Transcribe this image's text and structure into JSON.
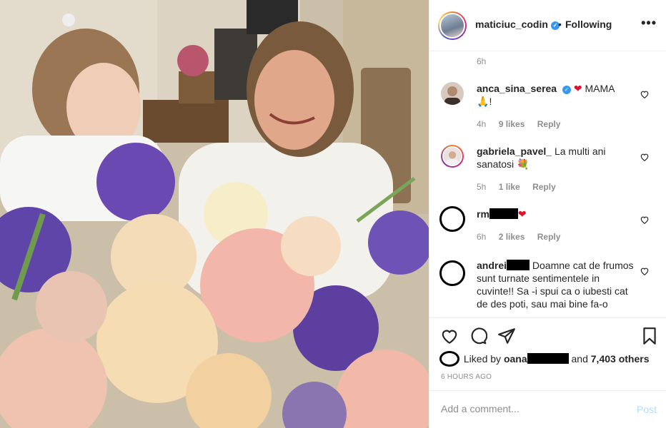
{
  "post": {
    "username": "maticiuc_codin",
    "separator": "•",
    "follow_status": "Following",
    "more_icon": "ellipsis-icon",
    "caption_time": "6h"
  },
  "comments": [
    {
      "username": "anca_sina_serea",
      "verified": true,
      "text": "MAMA",
      "text_suffix": "!",
      "emoji": [
        "red-heart",
        "folded-hands"
      ],
      "time": "4h",
      "likes": "9 likes",
      "reply": "Reply"
    },
    {
      "username": "gabriela_pavel_",
      "verified": false,
      "text": "La multi ani sanatosi",
      "emoji": [
        "bouquet"
      ],
      "time": "5h",
      "likes": "1 like",
      "reply": "Reply"
    },
    {
      "username": "rm",
      "redacted": true,
      "emoji": [
        "red-heart"
      ],
      "time": "6h",
      "likes": "2 likes",
      "reply": "Reply"
    },
    {
      "username": "andrei",
      "redacted": true,
      "text": "Doamne cat de frumos sunt turnate sentimentele in cuvinte!! Sa -i spui ca o iubesti cat de des poti, sau mai bine fa-o"
    }
  ],
  "actions": {
    "icons": [
      "heart-outline-icon",
      "comment-icon",
      "share-icon",
      "bookmark-icon"
    ]
  },
  "likes": {
    "prefix": "Liked by",
    "user": "oana",
    "joiner": "and",
    "others": "7,403 others"
  },
  "posted_ago": "6 HOURS AGO",
  "add_comment": {
    "placeholder": "Add a comment...",
    "post_label": "Post"
  }
}
